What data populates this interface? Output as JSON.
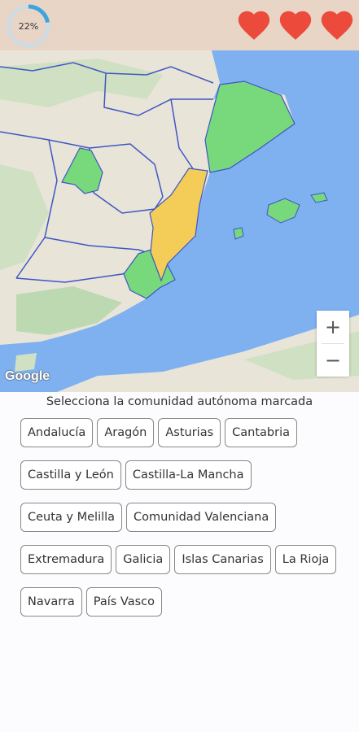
{
  "header": {
    "progress_label": "22%",
    "progress_value": 0.22,
    "lives": 3,
    "heart_color": "#ec4b3b",
    "progress_color": "#3fa3dd"
  },
  "map": {
    "attribution": "Google",
    "zoom_in_label": "+",
    "zoom_out_label": "−",
    "colors": {
      "sea": "#7fb1f1",
      "land": "#e8e4d8",
      "correct_region": "#77d97c",
      "target_region": "#f3cd58",
      "borders": "#3e56c4"
    }
  },
  "quiz": {
    "prompt": "Selecciona la comunidad autónoma marcada",
    "options": [
      "Andalucía",
      "Aragón",
      "Asturias",
      "Cantabria",
      "Castilla y León",
      "Castilla-La Mancha",
      "Ceuta y Melilla",
      "Comunidad Valenciana",
      "Extremadura",
      "Galicia",
      "Islas Canarias",
      "La Rioja",
      "Navarra",
      "País Vasco"
    ]
  }
}
